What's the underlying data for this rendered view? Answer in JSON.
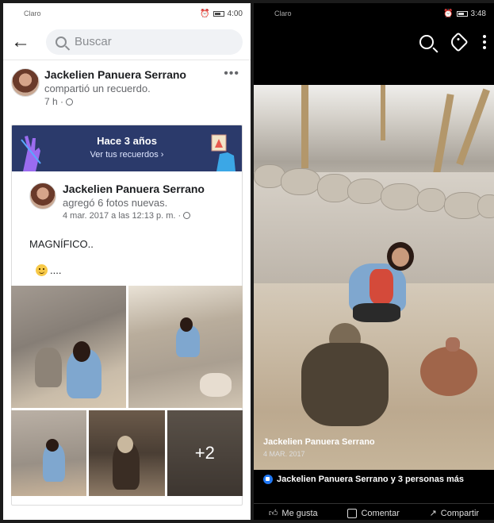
{
  "left_screen": {
    "status": {
      "carrier": "Claro",
      "time": "4:00"
    },
    "search": {
      "placeholder": "Buscar"
    },
    "post": {
      "author": "Jackelien Panuera Serrano",
      "action": "compartió un recuerdo.",
      "time": "7 h ·"
    },
    "memory_banner": {
      "title": "Hace 3 años",
      "link": "Ver tus recuerdos ›"
    },
    "shared_post": {
      "author": "Jackelien Panuera Serrano",
      "action": "agregó 6 fotos nuevas.",
      "date": "4 mar. 2017 a las 12:13 p. m. ·",
      "message": "MAGNÍFICO..",
      "emoji_suffix": "....",
      "more_photos": "+2"
    }
  },
  "right_screen": {
    "status": {
      "carrier": "Claro",
      "time": "3:48"
    },
    "caption": {
      "author": "Jackelien Panuera Serrano",
      "date": "4 MAR. 2017"
    },
    "reactions": "Jackelien Panuera Serrano y 3 personas más",
    "actions": {
      "like": "Me gusta",
      "comment": "Comentar",
      "share": "Compartir"
    }
  }
}
